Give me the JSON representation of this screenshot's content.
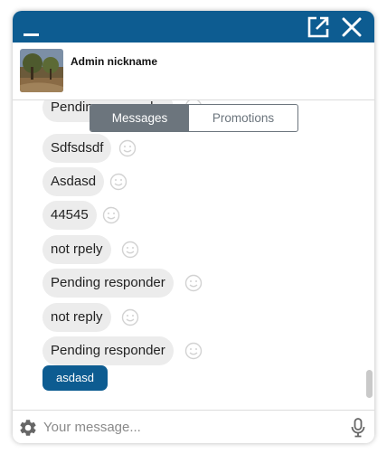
{
  "header": {
    "nickname": "Admin nickname"
  },
  "tabs": {
    "messages": "Messages",
    "promotions": "Promotions"
  },
  "messages": [
    "Pending responder",
    "Sdfsdsdf",
    "Asdasd",
    "44545",
    "not rpely",
    "Pending responder",
    "not reply",
    "Pending responder"
  ],
  "quick_reply": "asdasd",
  "composer": {
    "placeholder": "Your message..."
  },
  "colors": {
    "brand": "#0d5c91",
    "bubble": "#ececec",
    "tab_active": "#6c757d"
  },
  "icons": {
    "minimize": "minimize-icon",
    "popout": "external-link-icon",
    "close": "close-icon",
    "reaction": "smiley-icon",
    "settings": "gear-icon",
    "voice": "microphone-icon"
  }
}
